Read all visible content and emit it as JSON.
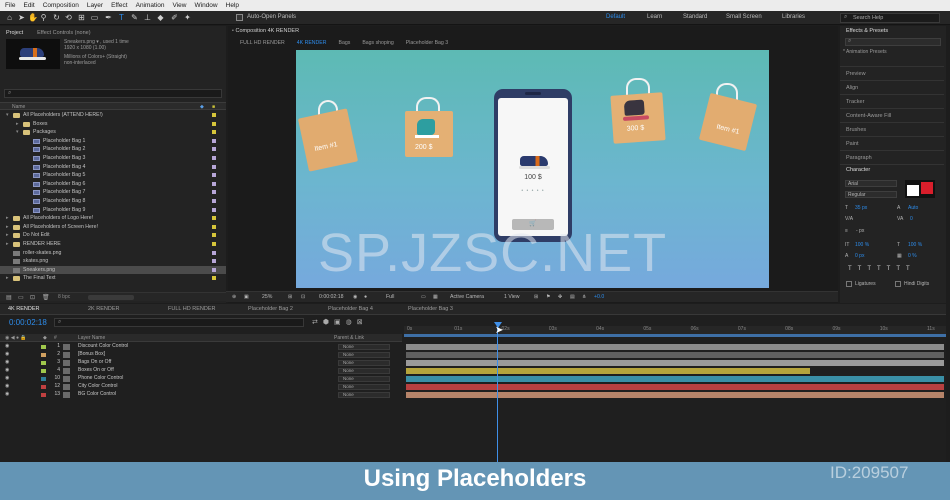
{
  "menu": [
    "File",
    "Edit",
    "Composition",
    "Layer",
    "Effect",
    "Animation",
    "View",
    "Window",
    "Help"
  ],
  "toolbar": {
    "auto_open_panels": "Auto-Open Panels",
    "workspaces": [
      "Default",
      "Learn",
      "Standard",
      "Small Screen",
      "Libraries"
    ],
    "search_help": "Search Help"
  },
  "project": {
    "tab_project": "Project",
    "tab_effect_controls": "Effect Controls (none)",
    "item_name": "Sneakers.png",
    "item_used": "▾ , used 1 time",
    "item_size": "1920 x 1080 (1.00)",
    "item_colors": "Millions of Colors+ (Straight)",
    "item_interlace": "non-interlaced",
    "col_name": "Name",
    "footer_filter": "8 bpc",
    "tree": [
      {
        "label": "All Placeholders (ATTEND HERE!)",
        "kind": "folder",
        "depth": 0,
        "open": true,
        "color": "#d6c53a"
      },
      {
        "label": "Boxes",
        "kind": "folder",
        "depth": 1,
        "open": false,
        "color": "#d6c53a"
      },
      {
        "label": "Packages",
        "kind": "folder",
        "depth": 1,
        "open": true,
        "color": "#d6c53a"
      },
      {
        "label": "Placeholder Bag 1",
        "kind": "comp",
        "depth": 2,
        "color": "#b7a6d8"
      },
      {
        "label": "Placeholder Bag 2",
        "kind": "comp",
        "depth": 2,
        "color": "#b7a6d8"
      },
      {
        "label": "Placeholder Bag 3",
        "kind": "comp",
        "depth": 2,
        "color": "#b7a6d8"
      },
      {
        "label": "Placeholder Bag 4",
        "kind": "comp",
        "depth": 2,
        "color": "#b7a6d8"
      },
      {
        "label": "Placeholder Bag 5",
        "kind": "comp",
        "depth": 2,
        "color": "#b7a6d8"
      },
      {
        "label": "Placeholder Bag 6",
        "kind": "comp",
        "depth": 2,
        "color": "#b7a6d8"
      },
      {
        "label": "Placeholder Bag 7",
        "kind": "comp",
        "depth": 2,
        "color": "#b7a6d8"
      },
      {
        "label": "Placeholder Bag 8",
        "kind": "comp",
        "depth": 2,
        "color": "#b7a6d8"
      },
      {
        "label": "Placeholder Bag 9",
        "kind": "comp",
        "depth": 2,
        "color": "#b7a6d8"
      },
      {
        "label": "All Placeholders of Logo Here!",
        "kind": "folder",
        "depth": 0,
        "open": false,
        "color": "#d6c53a"
      },
      {
        "label": "All Placeholders of Screen Here!",
        "kind": "folder",
        "depth": 0,
        "open": false,
        "color": "#d6c53a"
      },
      {
        "label": "Do Not Edit",
        "kind": "folder",
        "depth": 0,
        "open": false,
        "color": "#d6c53a"
      },
      {
        "label": "RENDER HERE",
        "kind": "folder",
        "depth": 0,
        "open": false,
        "color": "#d6c53a"
      },
      {
        "label": "roller-skates.png",
        "kind": "img",
        "depth": 0,
        "color": "#b7a6d8"
      },
      {
        "label": "skates.png",
        "kind": "img",
        "depth": 0,
        "color": "#b7a6d8"
      },
      {
        "label": "Sneakers.png",
        "kind": "img",
        "depth": 0,
        "color": "#b7a6d8",
        "selected": true
      },
      {
        "label": "The Final Text",
        "kind": "folder",
        "depth": 0,
        "open": false,
        "color": "#d6c53a"
      }
    ]
  },
  "composition": {
    "panel_title": "Composition 4K RENDER",
    "tabs": [
      "FULL HD RENDER",
      "4K RENDER",
      "Bags",
      "Bags shoping",
      "Placeholder Bag 3"
    ],
    "active_tab": 1,
    "bags": [
      "Item #1",
      "200 $",
      "300 $",
      "Item #1"
    ],
    "phone_price": "100 $",
    "phone_dots": "• • • • •",
    "watermark": "SP.JZSC.NET",
    "footer": {
      "zoom": "25%",
      "timecode": "0:00:02:18",
      "resolution": "Full",
      "camera": "Active Camera",
      "view": "1 View",
      "exposure": "+0.0"
    }
  },
  "right_panel": {
    "effects_presets": "Effects & Presets",
    "animation_presets": "* Animation Presets",
    "sections": [
      "Preview",
      "Align",
      "Tracker",
      "Content-Aware Fill",
      "Brushes",
      "Paint",
      "Paragraph"
    ],
    "character": "Character",
    "font_family": "Arial",
    "font_style": "Regular",
    "font_size": "35 px",
    "leading": "Auto",
    "tracking": "0",
    "stroke": "- px",
    "vscale": "100 %",
    "hscale": "100 %",
    "baseline": "0 px",
    "tsume": "0 %",
    "ligatures": "Ligatures",
    "hindi_digits": "Hindi Digits"
  },
  "timeline": {
    "tabs": [
      "4K RENDER",
      "2K RENDER",
      "FULL HD RENDER",
      "Placeholder Bag 2",
      "Placeholder Bag 4",
      "Placeholder Bag 3"
    ],
    "active_tab": 0,
    "timecode": "0:00:02:18",
    "col_layer_name": "Layer Name",
    "col_parent": "Parent & Link",
    "ruler": [
      "0s",
      "01s",
      "02s",
      "03s",
      "04s",
      "05s",
      "06s",
      "07s",
      "08s",
      "09s",
      "10s",
      "11s"
    ],
    "layers": [
      {
        "num": "1",
        "name": "Discount Color Control",
        "color": "#a0c84c",
        "parent": "None"
      },
      {
        "num": "2",
        "name": "[Bonus Box]",
        "color": "#d0a060",
        "parent": "None"
      },
      {
        "num": "3",
        "name": "Bags On or Off",
        "color": "#a0c84c",
        "parent": "None"
      },
      {
        "num": "4",
        "name": "Boxes On or Off",
        "color": "#a0c84c",
        "parent": "None"
      },
      {
        "num": "10",
        "name": "Phone Color Control",
        "color": "#2d7f9a",
        "parent": "None"
      },
      {
        "num": "12",
        "name": "City Color Control",
        "color": "#c04040",
        "parent": "None"
      },
      {
        "num": "13",
        "name": "BG Color Control",
        "color": "#c04040",
        "parent": "None"
      }
    ],
    "bars": [
      {
        "color": "#8c8c8c",
        "end": 1.0
      },
      {
        "color": "#606060",
        "end": 1.0
      },
      {
        "color": "#9a9a9a",
        "end": 1.0
      },
      {
        "color": "#b5a43c",
        "end": 0.75
      },
      {
        "color": "#3a8fa6",
        "end": 1.0
      },
      {
        "color": "#b84040",
        "end": 1.0
      },
      {
        "color": "#b6846a",
        "end": 1.0
      }
    ]
  },
  "caption": "Using Placeholders",
  "id_stamp": "ID:209507"
}
